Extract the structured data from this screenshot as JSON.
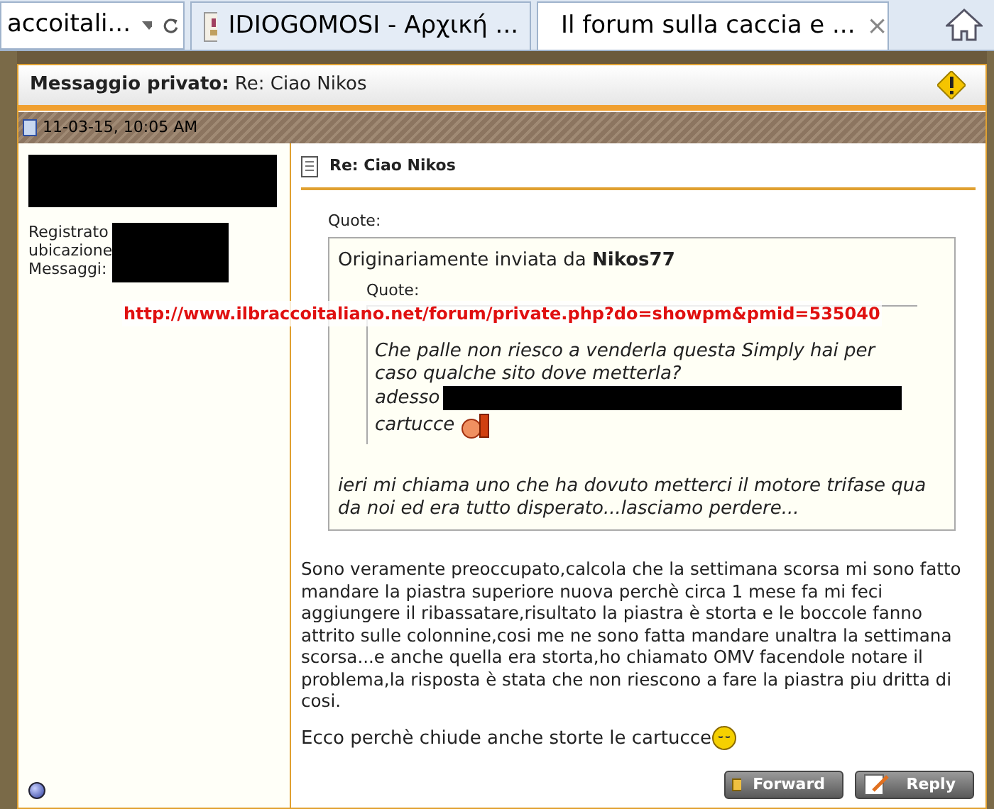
{
  "browser": {
    "address_fragment": "accoitali...",
    "tabs": [
      {
        "title": "IDIOGOMOSI - Αρχική ...",
        "selected": false
      },
      {
        "title": "Il forum sulla caccia e ...",
        "selected": true,
        "close": "×"
      }
    ]
  },
  "header": {
    "label": "Messaggio privato:",
    "subject": "Re: Ciao Nikos"
  },
  "date": "11-03-15, 10:05 AM",
  "sender": {
    "fields": [
      "Registrato",
      "ubicazione",
      "Messaggi:"
    ]
  },
  "post": {
    "title": "Re: Ciao Nikos",
    "quote_label": "Quote:",
    "quote_author_prefix": "Originariamente inviata da",
    "quote_author": "Nikos77",
    "inner_quote_label": "Quote:",
    "inner_lines": [
      "Che palle non riesco a venderla questa Simply hai per caso qualche sito dove metterla?",
      "adesso",
      "cartucce"
    ],
    "quote_text": "ieri mi chiama uno che ha dovuto metterci il motore trifase qua da noi ed era tutto disperato...lasciamo perdere...",
    "paragraphs": [
      "Sono veramente preoccupato,calcola che la settimana scorsa mi sono fatto mandare la piastra superiore nuova perchè circa 1 mese fa mi feci aggiungere il ribassatare,risultato la piastra è storta e le boccole fanno attrito sulle colonnine,cosi me ne sono fatta mandare unaltra la settimana scorsa...e anche quella era storta,ho chiamato OMV facendole notare il problema,la risposta è stata che non riescono a fare la piastra piu dritta di cosi.",
      "Ecco perchè chiude anche storte le cartucce"
    ]
  },
  "buttons": [
    "Forward",
    "Reply"
  ],
  "overlay_url": "http://www.ilbraccoitaliano.net/forum/private.php?do=showpm&pmid=535040"
}
